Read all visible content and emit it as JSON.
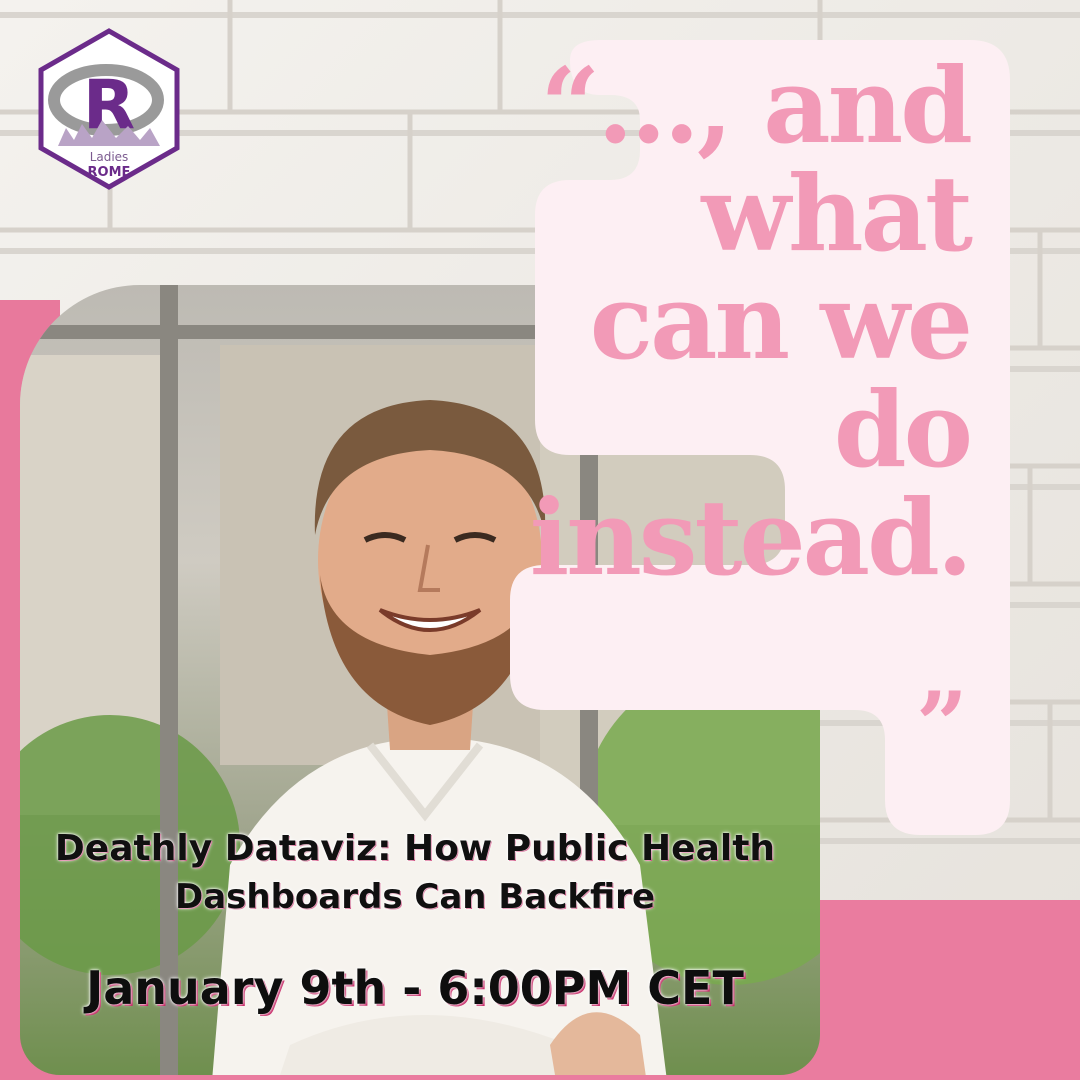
{
  "quote": {
    "open_mark": "“",
    "lines": [
      "“..., and",
      "what",
      "can we",
      "do",
      "instead."
    ],
    "close_mark": "”"
  },
  "logo": {
    "letter": "R",
    "label_top": "Ladies",
    "label_bottom": "ROME",
    "color": "#6b2b8a"
  },
  "event": {
    "title_line1": "Deathly Dataviz: How Public Health",
    "title_line2": "Dashboards Can Backfire",
    "date": "January 9th - 6:00PM CET"
  },
  "colors": {
    "quote_pink": "#f29ab7",
    "band_pink": "#ea7c9f",
    "blob_bg": "#fdeff3"
  }
}
